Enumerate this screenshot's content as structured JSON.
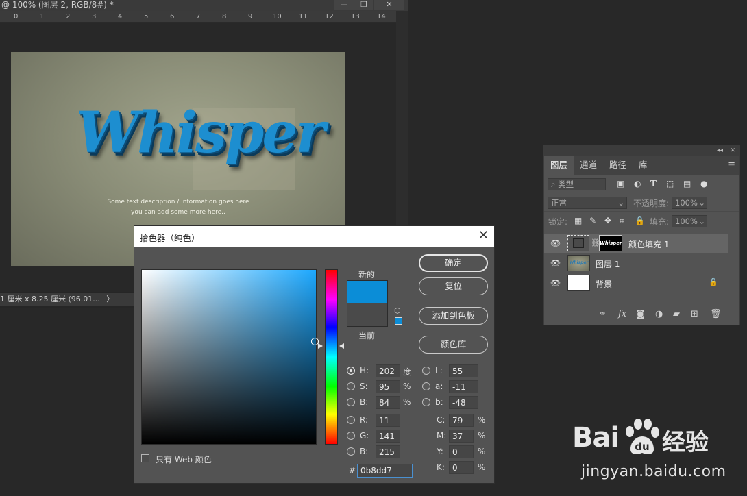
{
  "document": {
    "title": "@ 100% (图层 2, RGB/8#) *",
    "window_controls": {
      "minimize": "—",
      "restore": "❐",
      "close": "✕"
    },
    "ruler_labels": [
      "0",
      "1",
      "2",
      "3",
      "4",
      "5",
      "6",
      "7",
      "8",
      "9",
      "10",
      "11",
      "12",
      "13",
      "14"
    ],
    "status_text": "1 厘米 x 8.25 厘米 (96.01...",
    "status_arrow": "〉",
    "artwork": {
      "headline": "Whisper",
      "line1": "Some text description / information goes here",
      "line2": "you can add some more here.."
    }
  },
  "layers_panel": {
    "collapse_icon": "◂◂",
    "close_icon": "✕",
    "tabs": [
      "图层",
      "通道",
      "路径",
      "库"
    ],
    "active_tab": "图层",
    "menu_icon": "≡",
    "filter_label": "类型",
    "blend_mode": "正常",
    "opacity_label": "不透明度:",
    "opacity_value": "100%",
    "lock_label": "锁定:",
    "fill_label": "填充:",
    "fill_value": "100%",
    "thumb_text": "Whisper",
    "layers": [
      {
        "name": "颜色填充 1",
        "selected": true
      },
      {
        "name": "图层 1",
        "selected": false
      },
      {
        "name": "背景",
        "selected": false
      }
    ]
  },
  "color_picker": {
    "title": "拾色器（纯色）",
    "close_icon": "✕",
    "label_new": "新的",
    "label_current": "当前",
    "new_color": "#0b8dd7",
    "current_color": "#4a4a4a",
    "buttons": {
      "ok": "确定",
      "reset": "复位",
      "add_to_swatches": "添加到色板",
      "color_libraries": "颜色库"
    },
    "web_only_label": "只有 Web 颜色",
    "hsb": {
      "H": "202",
      "S": "95",
      "B": "84",
      "h_unit": "度",
      "pct": "%"
    },
    "lab": {
      "L": "55",
      "a": "-11",
      "b": "-48"
    },
    "rgb": {
      "R": "11",
      "G": "141",
      "B": "215"
    },
    "cmyk": {
      "C": "79",
      "M": "37",
      "Y": "0",
      "K": "0",
      "pct": "%"
    },
    "labels": {
      "H": "H:",
      "S": "S:",
      "Bv": "B:",
      "L": "L:",
      "a": "a:",
      "b": "b:",
      "R": "R:",
      "G": "G:",
      "Bc": "B:",
      "C": "C:",
      "M": "M:",
      "Y": "Y:",
      "K": "K:",
      "hash": "#"
    },
    "hex": "0b8dd7"
  },
  "watermark": {
    "logo_text": "Bai",
    "logo_text2": "经验",
    "url": "jingyan.baidu.com"
  }
}
